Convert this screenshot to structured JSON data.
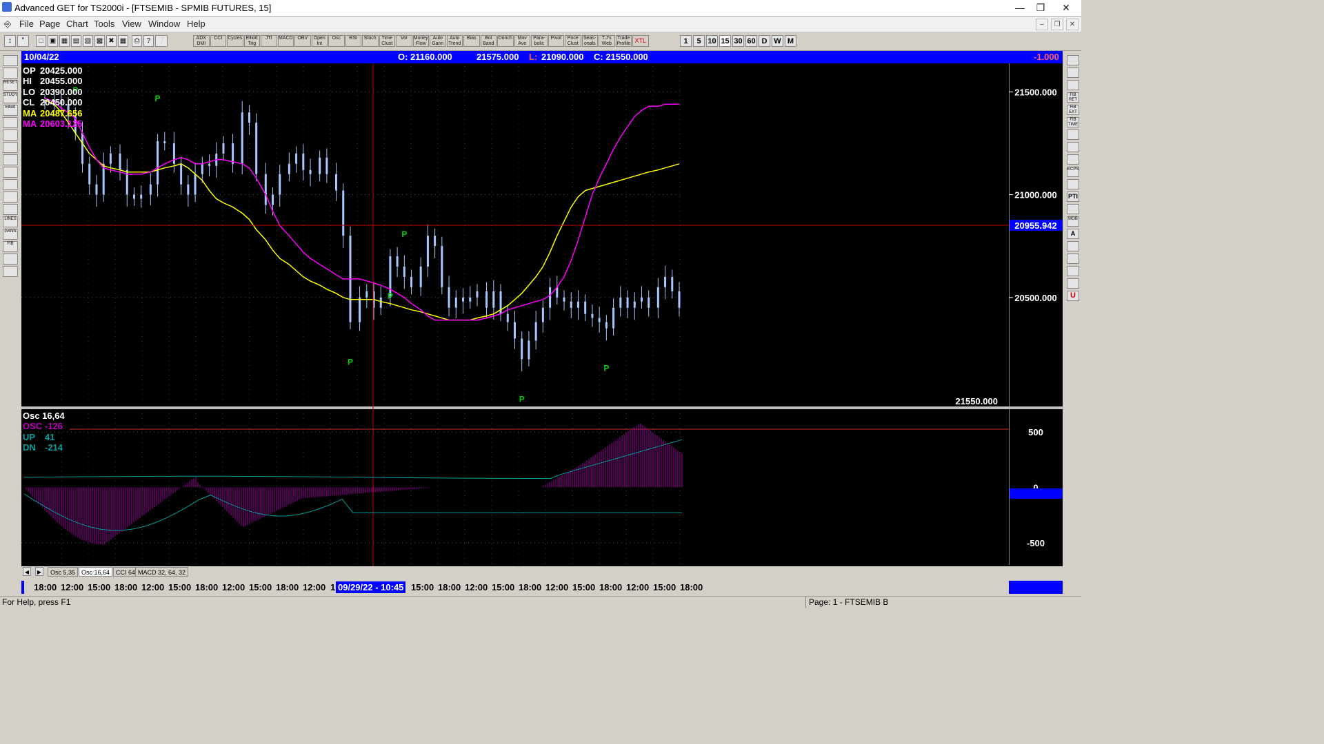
{
  "window": {
    "title": "Advanced GET for TS2000i - [FTSEMIB - SPMIB FUTURES, 15]"
  },
  "menu": [
    "File",
    "Page",
    "Chart",
    "Tools",
    "View",
    "Window",
    "Help"
  ],
  "toolbar": {
    "studies": [
      "ADX DMI",
      "CCI",
      "Cycles",
      "Elliott Trig",
      "JTI",
      "MACD",
      "OBV",
      "Open Int",
      "Osc",
      "RSI",
      "Stoch",
      "Time Clust",
      "Vol",
      "Money Flow",
      "Auto Gann",
      "Auto Trend",
      "Bias",
      "Bol Band",
      "Donch",
      "Mov Ave",
      "Para-bolic",
      "Pivot",
      "Price Clust",
      "Seas-onals",
      "T.J's Web",
      "Trade Profile",
      "XTL"
    ],
    "timeframes": [
      "1",
      "5",
      "10",
      "15",
      "30",
      "60",
      "D",
      "W",
      "M"
    ]
  },
  "lefttools": [
    "",
    "",
    "RESET",
    "STUDY",
    "Elliott",
    "",
    "",
    "",
    "",
    "",
    "",
    "",
    "",
    "LINES",
    "GANN",
    "FIB",
    "",
    ""
  ],
  "righttools": [
    "",
    "",
    "",
    "FIB RET",
    "FIB EXT",
    "FIB TIME",
    "",
    "",
    "",
    "ECPS",
    "",
    "PTI",
    "",
    "MOB",
    "A",
    "",
    "",
    "",
    "",
    "U"
  ],
  "infobar": {
    "date": "10/04/22",
    "open": "O: 21160.000",
    "high": "21575.000",
    "low_label": "L:",
    "low": "21090.000",
    "close": "C: 21550.000",
    "change": "-1.000"
  },
  "price_panel": {
    "ohlc": [
      {
        "label": "OP",
        "value": "20425.000"
      },
      {
        "label": "HI",
        "value": "20455.000"
      },
      {
        "label": "LO",
        "value": "20390.000"
      },
      {
        "label": "CL",
        "value": "20450.000"
      }
    ],
    "ma1": {
      "label": "MA",
      "value": "20487.656",
      "color": "#ffff00"
    },
    "ma2": {
      "label": "MA",
      "value": "20603.125",
      "color": "#ff00ff"
    },
    "cursor_price": "20955.942",
    "last_price_label": "21550.000",
    "pivot_mark": "P",
    "colors": {
      "candle": "#aac8ff",
      "cursor": "#c00000",
      "pivot": "#00d000"
    }
  },
  "osc_panel": {
    "title": "Osc 16,64",
    "lines": [
      {
        "label": "OSC",
        "value": "-126",
        "color": "#c000c0"
      },
      {
        "label": "UP",
        "value": "41",
        "color": "#00a0a0"
      },
      {
        "label": "DN",
        "value": "-214",
        "color": "#00a0a0"
      }
    ]
  },
  "tabs": [
    "Osc 5,35",
    "Osc 16,64",
    "CCI 64",
    "MACD 32, 64, 32"
  ],
  "timeaxis": {
    "labels": [
      "18:00",
      "12:00",
      "15:00",
      "18:00",
      "12:00",
      "15:00",
      "18:00",
      "12:00",
      "15:00",
      "18:00",
      "12:00",
      "1",
      "15:00",
      "18:00",
      "12:00",
      "15:00",
      "18:00",
      "12:00",
      "15:00",
      "18:00",
      "12:00",
      "15:00",
      "18:00"
    ],
    "cursor_label": "09/29/22 - 10:45"
  },
  "status": {
    "help": "For Help, press F1",
    "page": "Page: 1 - FTSEMIB B"
  },
  "chart_data": {
    "type": "line",
    "title": "",
    "xlabel": "",
    "ylabel": "",
    "ylim": [
      19990,
      21625
    ],
    "price_ticks": [
      "21500.000",
      "21000.000",
      "20500.000"
    ],
    "price_tick_values": [
      21500,
      21000,
      20500
    ],
    "osc_ticks": [
      "500",
      "0",
      "-500"
    ],
    "osc_tick_values": [
      500,
      0,
      -500
    ],
    "osc_ylim": [
      -700,
      680
    ],
    "x": [
      0,
      4,
      7,
      10,
      13,
      16,
      19,
      22,
      25,
      28,
      32,
      35,
      38,
      41,
      45,
      48,
      51,
      55,
      58,
      61,
      64,
      67,
      70,
      73,
      76,
      80,
      84,
      87,
      90,
      94,
      97,
      100,
      104,
      107,
      110,
      113,
      117,
      120,
      124,
      127,
      130,
      134,
      137,
      140,
      143,
      147,
      150,
      153,
      156,
      160,
      163,
      166,
      169,
      172,
      175,
      178,
      181,
      184,
      188,
      191,
      194,
      197,
      200,
      203,
      206,
      209,
      212,
      215,
      218,
      221,
      224,
      227,
      230,
      233,
      236,
      239,
      242,
      245,
      248,
      251,
      254,
      257,
      261,
      264,
      267,
      270
    ],
    "series": [
      {
        "name": "Price",
        "values": [
          21450,
          21460,
          21440,
          21380,
          21300,
          21150,
          21050,
          21000,
          21150,
          21200,
          21120,
          21000,
          20980,
          21000,
          21050,
          21260,
          21250,
          21150,
          21050,
          21000,
          21100,
          21150,
          21140,
          21200,
          21250,
          21150,
          21400,
          21350,
          21100,
          20950,
          21000,
          21100,
          21150,
          21200,
          21120,
          21100,
          21180,
          21100,
          21020,
          20800,
          20380,
          20500,
          20530,
          20450,
          20500,
          20700,
          20650,
          20600,
          20550,
          20650,
          20800,
          20750,
          20550,
          20450,
          20500,
          20480,
          20500,
          20530,
          20450,
          20530,
          20420,
          20380,
          20300,
          20200,
          20290,
          20380,
          20450,
          20550,
          20500,
          20480,
          20450,
          20480,
          20420,
          20400,
          20380,
          20350,
          20450,
          20500,
          20450,
          20480,
          20500,
          20450,
          20550,
          20600,
          20530,
          20450
        ]
      },
      {
        "name": "MA",
        "values": [
          21460,
          21440,
          21400,
          21350,
          21300,
          21250,
          21200,
          21170,
          21140,
          21130,
          21120,
          21110,
          21110,
          21110,
          21110,
          21120,
          21130,
          21140,
          21150,
          21130,
          21100,
          21070,
          21020,
          20980,
          20960,
          20940,
          20910,
          20880,
          20830,
          20780,
          20730,
          20690,
          20660,
          20630,
          20600,
          20580,
          20560,
          20540,
          20520,
          20500,
          20490,
          20490,
          20490,
          20490,
          20480,
          20470,
          20460,
          20450,
          20440,
          20430,
          20420,
          20410,
          20400,
          20390,
          20390,
          20390,
          20390,
          20400,
          20410,
          20420,
          20440,
          20460,
          20490,
          20520,
          20560,
          20600,
          20650,
          20720,
          20800,
          20870,
          20940,
          20990,
          21020,
          21030,
          21040,
          21050,
          21060,
          21070,
          21080,
          21090,
          21100,
          21110,
          21120,
          21130,
          21140,
          21150
        ]
      },
      {
        "name": "MA",
        "values": [
          21470,
          21450,
          21420,
          21400,
          21370,
          21300,
          21230,
          21170,
          21130,
          21120,
          21110,
          21100,
          21100,
          21100,
          21110,
          21130,
          21150,
          21170,
          21180,
          21170,
          21150,
          21150,
          21160,
          21170,
          21170,
          21160,
          21150,
          21130,
          21080,
          21000,
          20920,
          20850,
          20800,
          20760,
          20720,
          20690,
          20660,
          20640,
          20610,
          20590,
          20590,
          20590,
          20580,
          20570,
          20560,
          20540,
          20520,
          20500,
          20470,
          20440,
          20410,
          20390,
          20390,
          20390,
          20390,
          20390,
          20390,
          20390,
          20400,
          20410,
          20420,
          20440,
          20450,
          20460,
          20470,
          20480,
          20490,
          20510,
          20550,
          20600,
          20680,
          20780,
          20890,
          21000,
          21080,
          21150,
          21220,
          21280,
          21330,
          21380,
          21410,
          21430,
          21430,
          21440,
          21440,
          21440
        ]
      }
    ]
  }
}
